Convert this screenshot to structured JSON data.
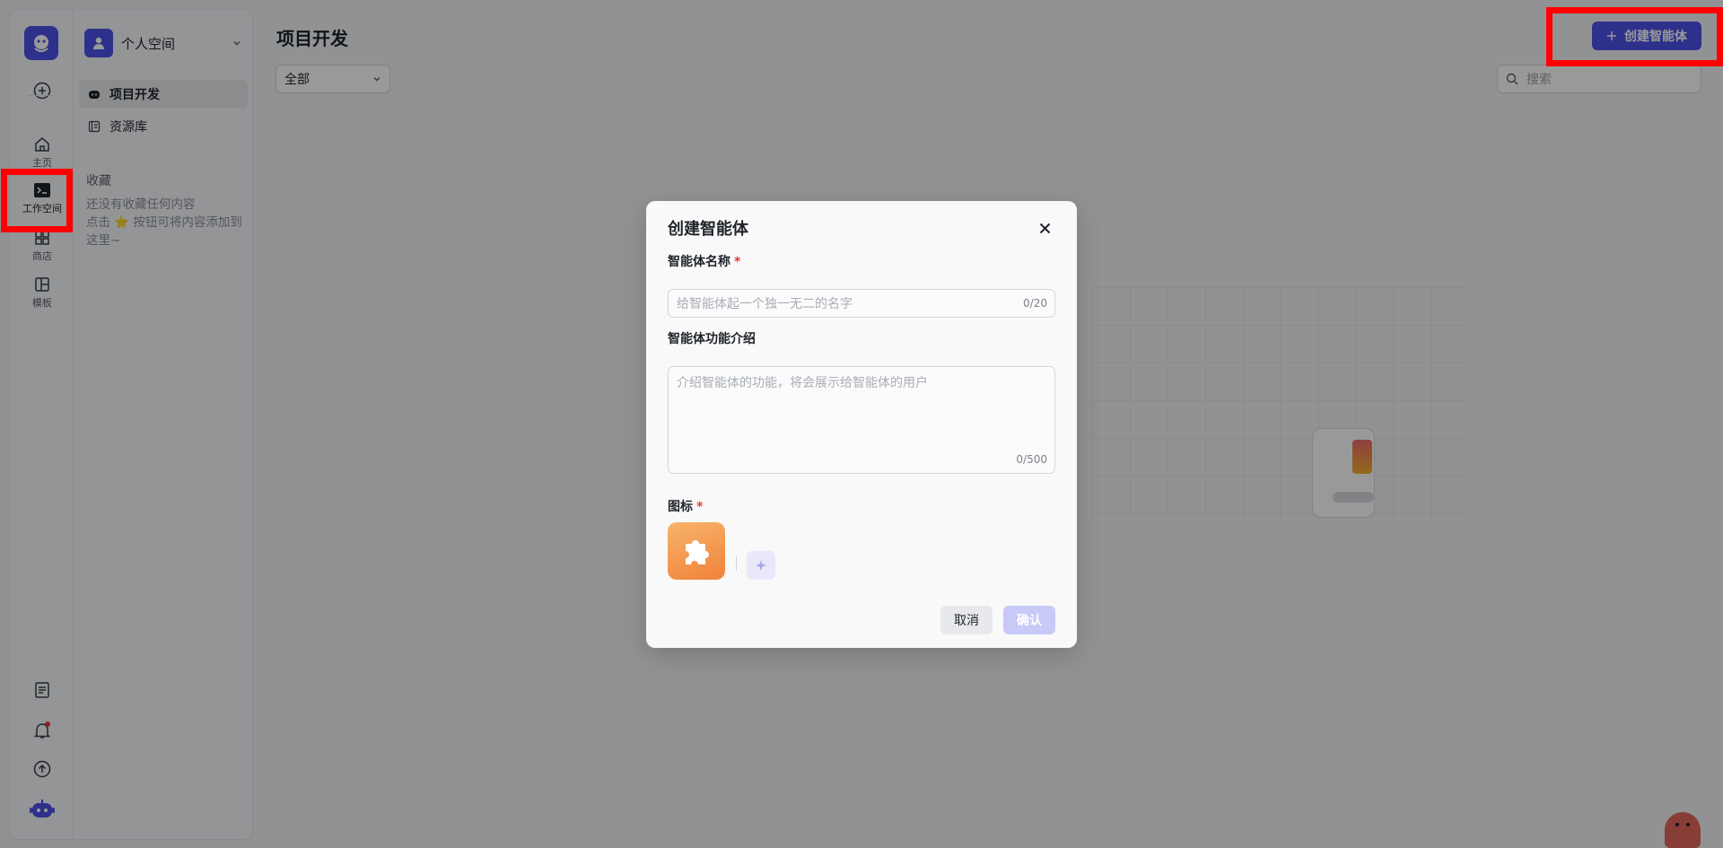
{
  "rail": {
    "items": [
      {
        "label": "主页",
        "icon": "home-icon"
      },
      {
        "label": "工作空间",
        "icon": "terminal-icon"
      },
      {
        "label": "商店",
        "icon": "store-icon"
      },
      {
        "label": "模板",
        "icon": "layout-icon"
      }
    ]
  },
  "sidebar": {
    "space_name": "个人空间",
    "items": [
      {
        "label": "项目开发",
        "icon": "bot-icon"
      },
      {
        "label": "资源库",
        "icon": "library-icon"
      }
    ],
    "favorites_title": "收藏",
    "favorites_empty_line1": "还没有收藏任何内容",
    "favorites_empty_line2": "点击 ⭐ 按钮可将内容添加到这里~"
  },
  "main": {
    "title": "项目开发",
    "filter_value": "全部",
    "search_placeholder": "搜索",
    "create_button": "创建智能体"
  },
  "modal": {
    "title": "创建智能体",
    "name_label": "智能体名称",
    "name_placeholder": "给智能体起一个独一无二的名字",
    "name_counter": "0/20",
    "desc_label": "智能体功能介绍",
    "desc_placeholder": "介绍智能体的功能，将会展示给智能体的用户",
    "desc_counter": "0/500",
    "icon_label": "图标",
    "required_mark": "*",
    "cancel": "取消",
    "confirm": "确认"
  },
  "colors": {
    "accent": "#4d53e8",
    "highlight": "#ff0000",
    "required": "#e53935"
  }
}
